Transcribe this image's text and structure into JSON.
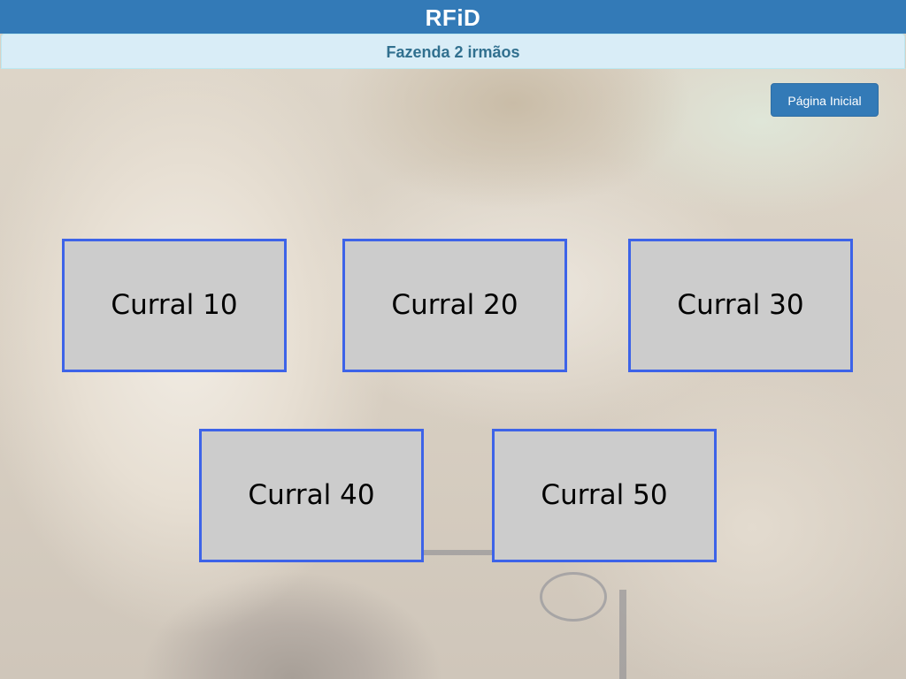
{
  "header": {
    "title": "RFiD"
  },
  "subheader": {
    "farm_name": "Fazenda 2 irmãos"
  },
  "actions": {
    "home_label": "Página Inicial"
  },
  "corrals": [
    {
      "label": "Curral 10"
    },
    {
      "label": "Curral 20"
    },
    {
      "label": "Curral 30"
    },
    {
      "label": "Curral 40"
    },
    {
      "label": "Curral 50"
    }
  ],
  "colors": {
    "primary": "#337ab7",
    "subheader_bg": "#d9edf7",
    "subheader_text": "#31708f",
    "tile_bg": "#cccccc",
    "tile_border": "#3d63e8"
  }
}
